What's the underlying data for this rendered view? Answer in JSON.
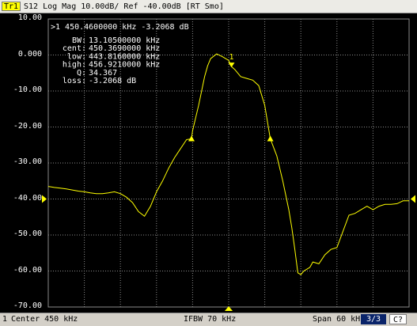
{
  "header": {
    "trace_tag": "Tr1",
    "title": "S12 Log Mag 10.00dB/ Ref -40.00dB [RT Smo]"
  },
  "y_axis": {
    "ticks": [
      "10.00",
      "0.000",
      "-10.00",
      "-20.00",
      "-30.00",
      "-40.00",
      "-50.00",
      "-60.00",
      "-70.00"
    ]
  },
  "marker": {
    "line": ">1  450.4600000 kHz -3.2068 dB",
    "label": "1",
    "stats": [
      {
        "name": "BW:",
        "value": "13.10500000 kHz"
      },
      {
        "name": "cent:",
        "value": "450.3690000 kHz"
      },
      {
        "name": "low:",
        "value": "443.8160000 kHz"
      },
      {
        "name": "high:",
        "value": "456.9210000 kHz"
      },
      {
        "name": "Q:",
        "value": "34.367"
      },
      {
        "name": "loss:",
        "value": "-3.2068 dB"
      }
    ]
  },
  "statusbar": {
    "channel": "1",
    "center": "Center 450 kHz",
    "ifbw": "IFBW 70 kHz",
    "span": "Span 60 kHz",
    "page": "3/3",
    "mode": "C?"
  },
  "colors": {
    "trace": "#ffff00",
    "grid": "#8a8a8a",
    "background": "#000000",
    "page_box": "#0a246a",
    "page_text": "#ffffff"
  },
  "chart_data": {
    "type": "line",
    "title": "S12 Log Mag 10.00dB/ Ref -40.00dB [RT Smo]",
    "xlabel": "",
    "ylabel": "",
    "xlim": [
      420,
      480
    ],
    "ylim": [
      -70,
      10
    ],
    "x_unit": "kHz",
    "y_unit": "dB",
    "grid": true,
    "series": [
      {
        "x": [
          420,
          421,
          422,
          423,
          424,
          425,
          426,
          427,
          428,
          429,
          430,
          431,
          432,
          433,
          434,
          435,
          436,
          437,
          438,
          439,
          440,
          441,
          442,
          443,
          443.8,
          444,
          445,
          446,
          446.5,
          447,
          448,
          449,
          450,
          450.46,
          451,
          452,
          453,
          454,
          455,
          456,
          456.92,
          457,
          458,
          459,
          460,
          460.5,
          461,
          461.5,
          462,
          462.5,
          463,
          463.5,
          464,
          465,
          466,
          467,
          468,
          469,
          470,
          471,
          472,
          473,
          474,
          475,
          476,
          477,
          478,
          479,
          480
        ],
        "y": [
          -36.5,
          -36.8,
          -37.0,
          -37.2,
          -37.5,
          -37.8,
          -38.0,
          -38.3,
          -38.5,
          -38.5,
          -38.3,
          -38.0,
          -38.5,
          -39.5,
          -41.0,
          -43.5,
          -44.8,
          -42.0,
          -38.0,
          -35.0,
          -31.5,
          -28.5,
          -26.0,
          -23.5,
          -23.3,
          -21.0,
          -14.0,
          -6.0,
          -3.0,
          -1.0,
          0.3,
          -0.5,
          -1.5,
          -3.2,
          -4.0,
          -6.0,
          -6.5,
          -7.0,
          -8.5,
          -14.0,
          -23.3,
          -23.6,
          -28.0,
          -35.0,
          -43.0,
          -48.0,
          -54.0,
          -60.5,
          -61.0,
          -60.0,
          -59.5,
          -59.0,
          -57.5,
          -58.0,
          -55.5,
          -54.0,
          -53.5,
          -49.0,
          -44.5,
          -44.0,
          -43.0,
          -42.0,
          -43.0,
          -42.0,
          -41.5,
          -41.5,
          -41.3,
          -40.5,
          -40.5
        ]
      }
    ],
    "markers": [
      {
        "label": "1",
        "x": 450.46,
        "y": -3.2068
      },
      {
        "x": 443.816,
        "y": -23.3
      },
      {
        "x": 456.921,
        "y": -23.3
      }
    ]
  }
}
